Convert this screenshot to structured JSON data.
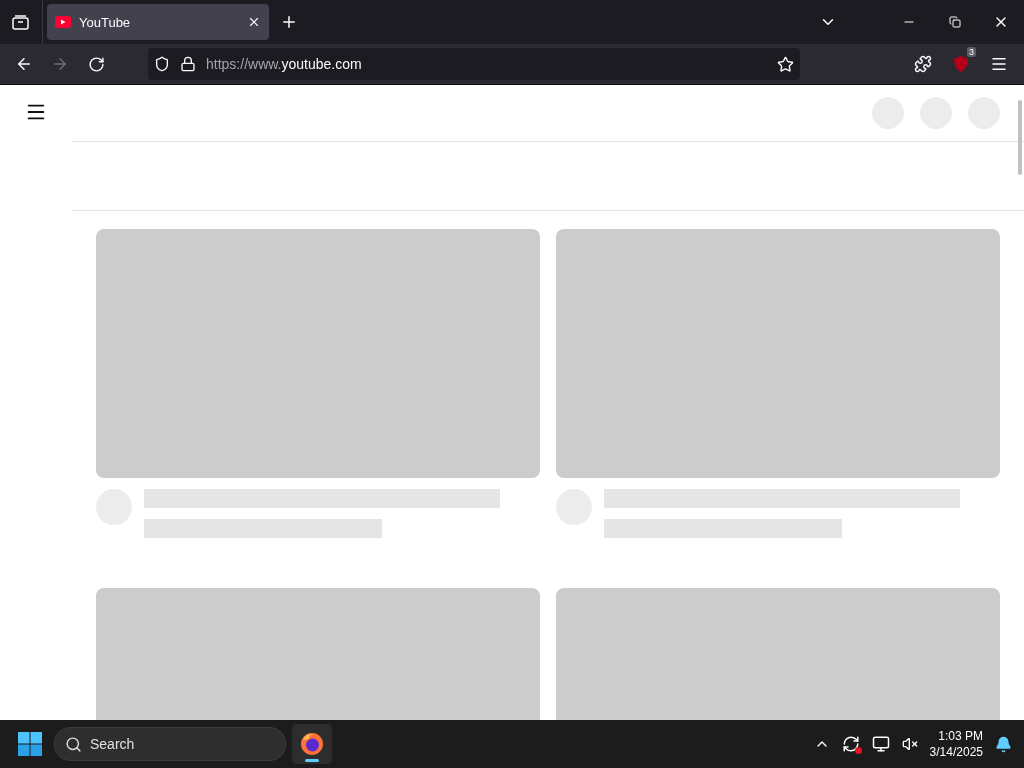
{
  "tabs": [
    {
      "title": "YouTube",
      "selected": true
    }
  ],
  "navigation": {
    "back_disabled": false,
    "forward_disabled": true
  },
  "address_bar": {
    "url": "https://www.**youtube.com**"
  },
  "extensions": {
    "blocker_badge": "3"
  },
  "feed": {
    "cards": [
      {
        "kind": "skeleton"
      },
      {
        "kind": "skeleton"
      },
      {
        "kind": "thumbnail"
      },
      {
        "kind": "thumbnail"
      }
    ]
  },
  "taskbar": {
    "search": {
      "placeholder": "Search"
    },
    "apps": [
      {
        "kind": "browser",
        "selected": true
      }
    ],
    "clock": {
      "time": "1:03 PM",
      "date": "3/14/2025"
    }
  }
}
